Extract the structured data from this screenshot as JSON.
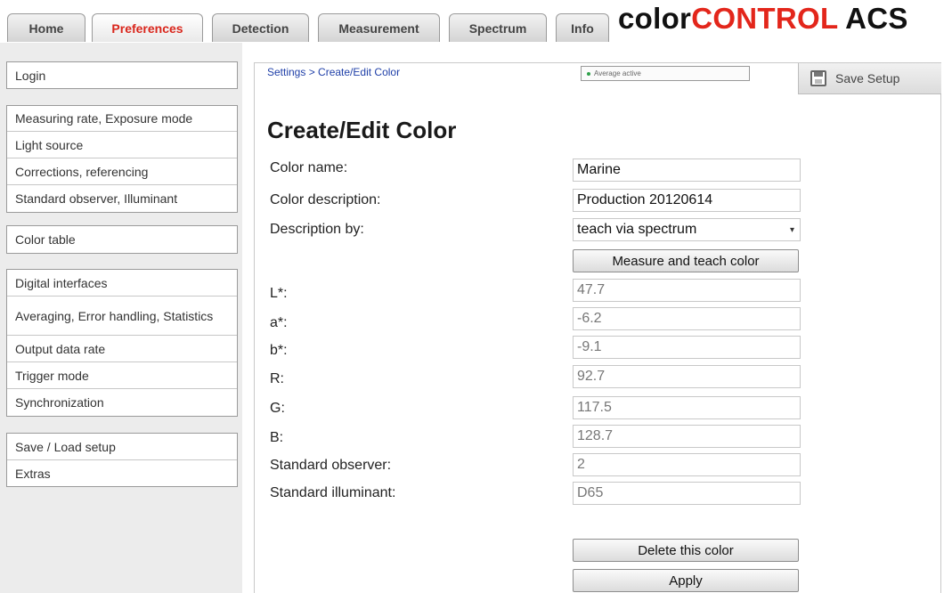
{
  "nav": {
    "tabs": [
      {
        "label": "Home"
      },
      {
        "label": "Preferences"
      },
      {
        "label": "Detection"
      },
      {
        "label": "Measurement"
      },
      {
        "label": "Spectrum"
      },
      {
        "label": "Info"
      }
    ],
    "active_tab": "Preferences"
  },
  "brand": {
    "prefix": "color",
    "accent": "CONTROL",
    "suffix": " ACS"
  },
  "sidebar": {
    "groups": [
      [
        "Login"
      ],
      [
        "Measuring rate, Exposure mode",
        "Light source",
        "Corrections, referencing",
        "Standard observer, Illuminant"
      ],
      [
        "Color table"
      ],
      [
        "Digital interfaces",
        "Averaging, Error handling, Statistics",
        "Output data rate",
        "Trigger mode",
        "Synchronization"
      ],
      [
        "Save / Load setup",
        "Extras"
      ]
    ]
  },
  "breadcrumb": "Settings > Create/Edit Color",
  "status": {
    "text": "Average active",
    "color": "#2ea04a"
  },
  "save_setup": {
    "label": "Save Setup",
    "icon": "floppy-disk-icon"
  },
  "page_title": "Create/Edit Color",
  "form": {
    "color_name": {
      "label": "Color name:",
      "value": "Marine"
    },
    "color_description": {
      "label": "Color description:",
      "value": "Production 20120614"
    },
    "description_by": {
      "label": "Description by:",
      "value": "teach via spectrum"
    },
    "measure_button": "Measure and teach color",
    "values": [
      {
        "label": "L*:",
        "value": "47.7"
      },
      {
        "label": "a*:",
        "value": "-6.2"
      },
      {
        "label": "b*:",
        "value": "-9.1"
      },
      {
        "label": "R:",
        "value": "92.7"
      },
      {
        "label": "G:",
        "value": "117.5"
      },
      {
        "label": "B:",
        "value": "128.7"
      },
      {
        "label": "Standard observer:",
        "value": "2"
      },
      {
        "label": "Standard illuminant:",
        "value": "D65"
      }
    ],
    "delete_button": "Delete this color",
    "apply_button": "Apply"
  },
  "colors": {
    "accent": "#e3261b",
    "link": "#1f3fa8"
  }
}
